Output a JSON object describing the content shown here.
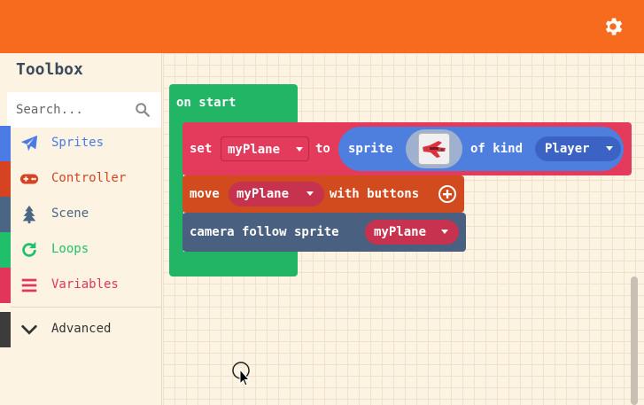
{
  "header": {
    "settings_icon": "gear-icon",
    "color": "#f76b1f"
  },
  "toolbox": {
    "title": "Toolbox",
    "search": {
      "placeholder": "Search...",
      "value": ""
    },
    "categories": [
      {
        "label": "Sprites",
        "icon": "paper-plane-icon",
        "color": "#4b7be5"
      },
      {
        "label": "Controller",
        "icon": "gamepad-icon",
        "color": "#d54322"
      },
      {
        "label": "Scene",
        "icon": "tree-icon",
        "color": "#4b6584"
      },
      {
        "label": "Loops",
        "icon": "refresh-icon",
        "color": "#20bf6b"
      },
      {
        "label": "Variables",
        "icon": "list-icon",
        "color": "#e2355a"
      }
    ],
    "advanced": {
      "label": "Advanced",
      "icon": "chevron-down-icon",
      "color": "#3c3c3c"
    }
  },
  "workspace": {
    "on_start": {
      "label": "on start"
    },
    "set_block": {
      "set_text": "set",
      "variable": "myPlane",
      "to_text": "to",
      "sprite_text": "sprite",
      "of_kind_text": "of kind",
      "kind": "Player"
    },
    "move_block": {
      "move_text": "move",
      "variable": "myPlane",
      "with_buttons_text": "with buttons"
    },
    "camera_block": {
      "text": "camera follow sprite",
      "variable": "myPlane"
    }
  }
}
